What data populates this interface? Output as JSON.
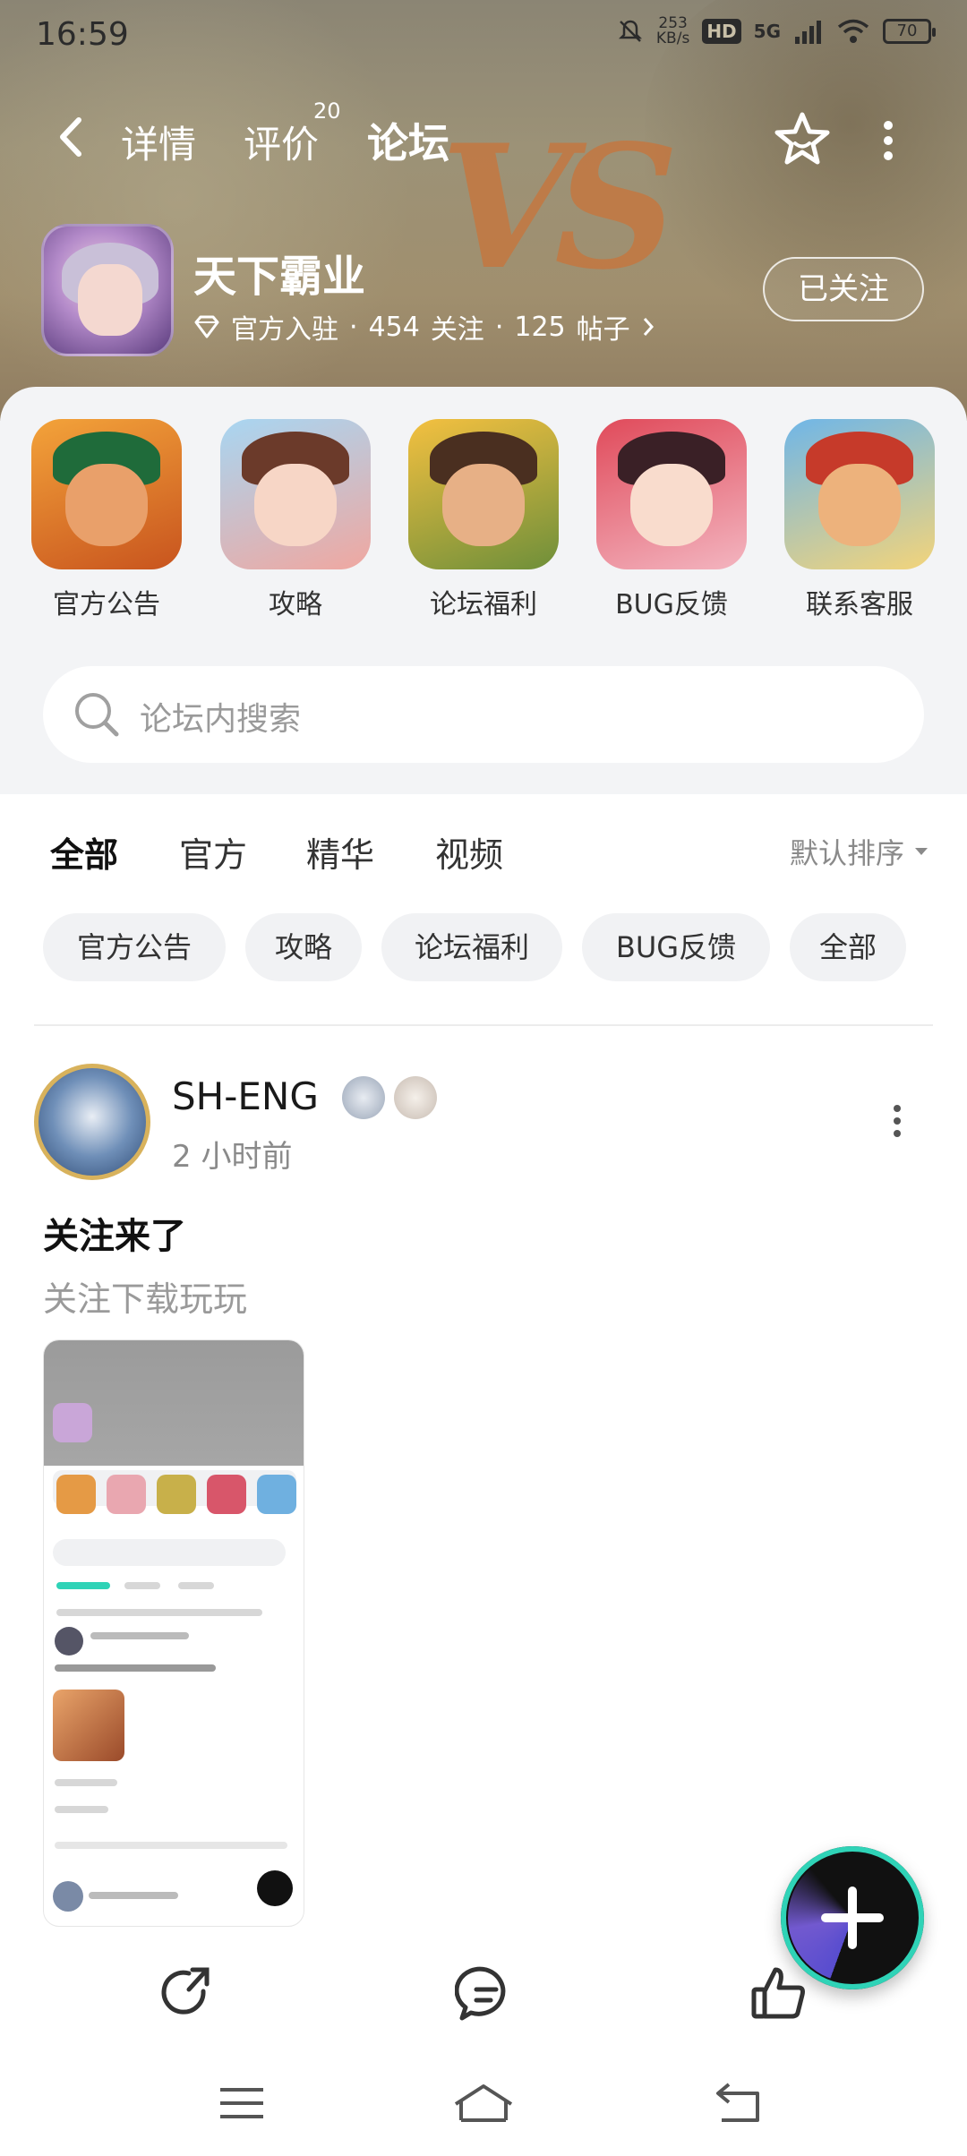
{
  "status_bar": {
    "time": "16:59",
    "speed_value": "253",
    "speed_unit": "KB/s",
    "hd": "HD",
    "network": "5G",
    "battery": "70"
  },
  "nav": {
    "tabs": [
      {
        "label": "详情"
      },
      {
        "label": "评价",
        "count": "20"
      },
      {
        "label": "论坛"
      }
    ]
  },
  "game": {
    "title": "天下霸业",
    "official": "官方入驻",
    "followers": "454",
    "followers_label": "关注",
    "posts": "125",
    "posts_label": "帖子",
    "follow_button": "已关注"
  },
  "categories": [
    {
      "label": "官方公告",
      "icon": "guan-yu-avatar"
    },
    {
      "label": "攻略",
      "icon": "maiden-avatar"
    },
    {
      "label": "论坛福利",
      "icon": "warrior-avatar"
    },
    {
      "label": "BUG反馈",
      "icon": "smiling-girl-avatar"
    },
    {
      "label": "联系客服",
      "icon": "general-avatar"
    }
  ],
  "search": {
    "placeholder": "论坛内搜索"
  },
  "filter_tabs": [
    "全部",
    "官方",
    "精华",
    "视频"
  ],
  "sort": {
    "label": "默认排序"
  },
  "chips": [
    "官方公告",
    "攻略",
    "论坛福利",
    "BUG反馈",
    "全部"
  ],
  "post": {
    "username": "SH-ENG",
    "time": "2 小时前",
    "title": "关注来了",
    "body": "关注下载玩玩"
  },
  "colors": {
    "accent": "#2fd3b7",
    "banner": "#9c9277",
    "sheet_bg": "#f3f4f6"
  }
}
